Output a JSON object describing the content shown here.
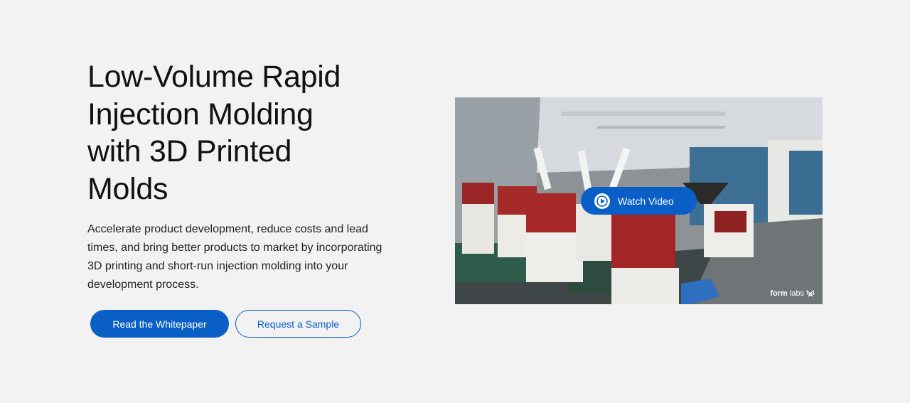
{
  "hero": {
    "title": "Low-Volume Rapid Injection Molding with 3D Printed Molds",
    "description": "Accelerate product development, reduce costs and lead times, and bring better products to market by incorporating 3D printing and short-run injection molding into your development process.",
    "primary_button": "Read the Whitepaper",
    "secondary_button": "Request a Sample"
  },
  "video": {
    "watch_label": "Watch Video",
    "brand_bold": "form",
    "brand_light": "labs",
    "play_icon": "play-icon",
    "brand_icon": "butterfly-icon"
  },
  "colors": {
    "accent": "#0a5fc6",
    "background": "#f2f2f2",
    "text": "#111111"
  }
}
